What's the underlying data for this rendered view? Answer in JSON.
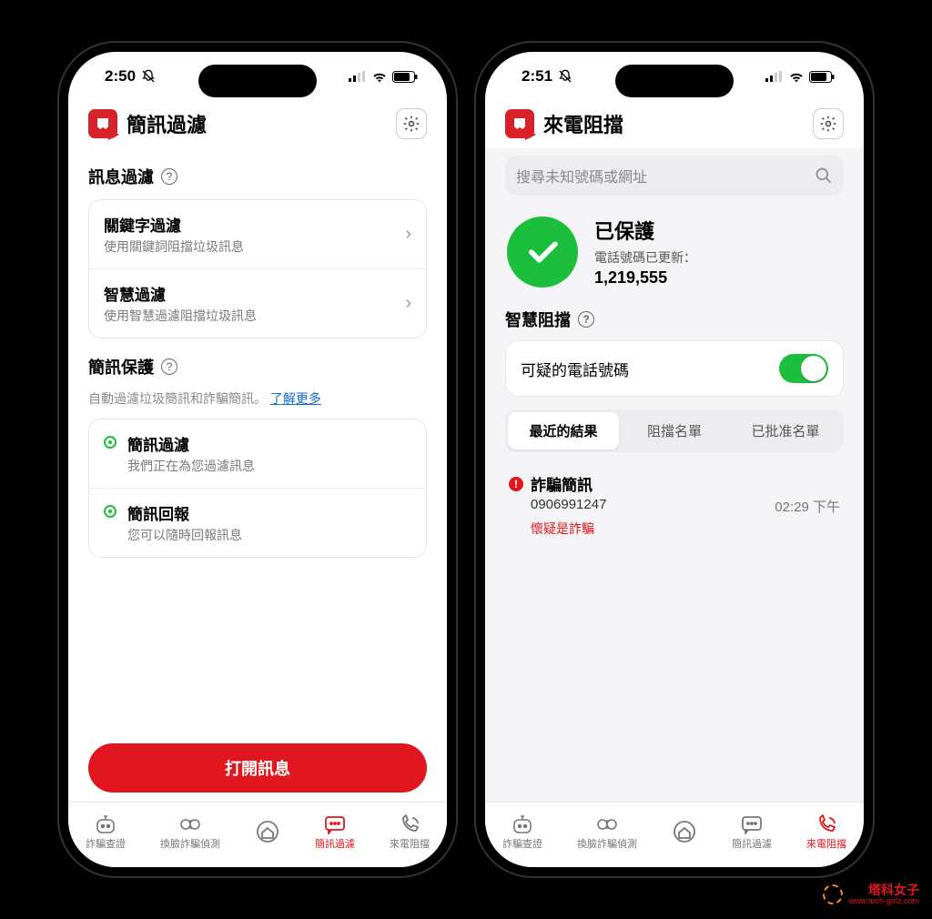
{
  "left": {
    "time": "2:50",
    "app_title": "簡訊過濾",
    "section1_title": "訊息過濾",
    "rows": [
      {
        "title": "關鍵字過濾",
        "sub": "使用關鍵詞阻擋垃圾訊息"
      },
      {
        "title": "智慧過濾",
        "sub": "使用智慧過濾阻擋垃圾訊息"
      }
    ],
    "section2_title": "簡訊保護",
    "section2_desc": "自動過濾垃圾簡訊和詐騙簡訊。",
    "section2_link": "了解更多",
    "bullets": [
      {
        "title": "簡訊過濾",
        "sub": "我們正在為您過濾訊息"
      },
      {
        "title": "簡訊回報",
        "sub": "您可以隨時回報訊息"
      }
    ],
    "cta": "打開訊息",
    "tabs": [
      "詐騙查證",
      "換臉詐騙偵測",
      "",
      "簡訊過濾",
      "來電阻擋"
    ],
    "active_tab": 3
  },
  "right": {
    "time": "2:51",
    "app_title": "來電阻擋",
    "search_placeholder": "搜尋未知號碼或網址",
    "protected_title": "已保護",
    "protected_sub": "電話號碼已更新：",
    "protected_count": "1,219,555",
    "smart_block_title": "智慧阻擋",
    "toggle_label": "可疑的電話號碼",
    "toggle_on": true,
    "segments": [
      "最近的結果",
      "阻擋名單",
      "已批准名單"
    ],
    "active_segment": 0,
    "recent": {
      "label": "詐騙簡訊",
      "number": "0906991247",
      "time": "02:29 下午",
      "tag": "懷疑是詐騙"
    },
    "tabs": [
      "詐騙查證",
      "換臉詐騙偵測",
      "",
      "簡訊過濾",
      "來電阻擋"
    ],
    "active_tab": 4
  },
  "watermark": {
    "text": "塔科女子",
    "url": "www.tech-girlz.com"
  }
}
